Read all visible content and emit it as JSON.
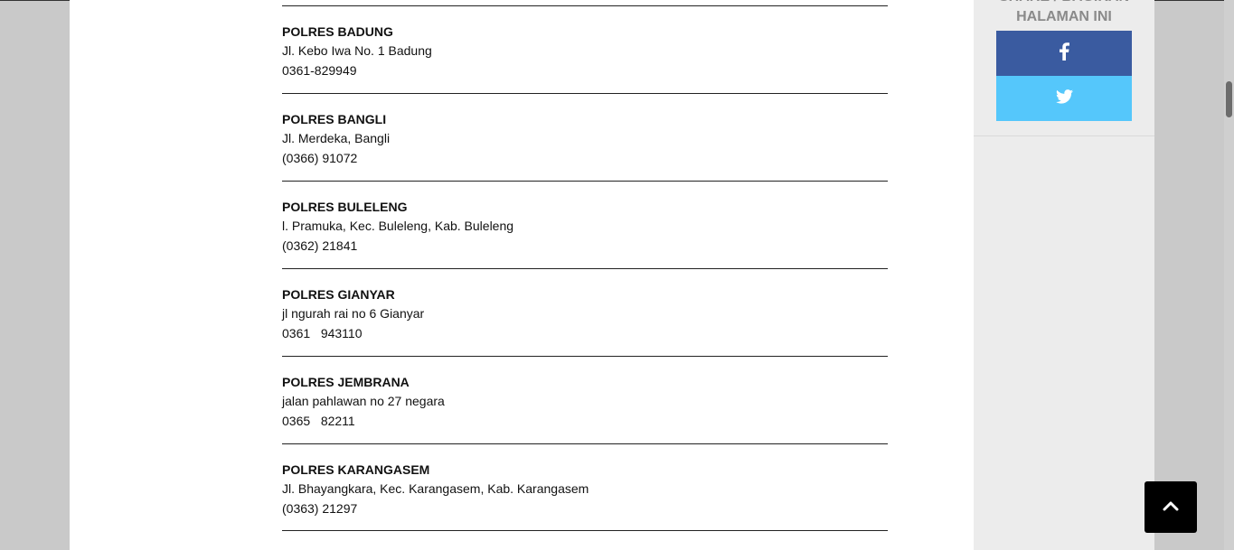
{
  "sidebar": {
    "share_title_line1": "SHARE / BAGIKAN",
    "share_title_line2": "HALAMAN INI",
    "facebook_icon": "facebook-icon",
    "twitter_icon": "twitter-icon",
    "colors": {
      "facebook": "#3a5ba0",
      "twitter": "#55c7fb"
    }
  },
  "entries": [
    {
      "name": "POLRES BADUNG",
      "address": "Jl. Kebo Iwa No. 1 Badung",
      "phone": "0361-829949"
    },
    {
      "name": "POLRES BANGLI",
      "address": "Jl. Merdeka, Bangli",
      "phone": "(0366) 91072"
    },
    {
      "name": "POLRES BULELENG",
      "address": "l. Pramuka, Kec. Buleleng, Kab. Buleleng",
      "phone": "(0362) 21841"
    },
    {
      "name": "POLRES GIANYAR",
      "address": "jl ngurah rai no 6 Gianyar",
      "phone": "0361   943110"
    },
    {
      "name": "POLRES JEMBRANA",
      "address": "jalan pahlawan no 27 negara",
      "phone": "0365   82211"
    },
    {
      "name": "POLRES KARANGASEM",
      "address": "Jl. Bhayangkara, Kec. Karangasem, Kab. Karangasem",
      "phone": "(0363) 21297"
    }
  ],
  "back_to_top_icon": "chevron-up-icon"
}
